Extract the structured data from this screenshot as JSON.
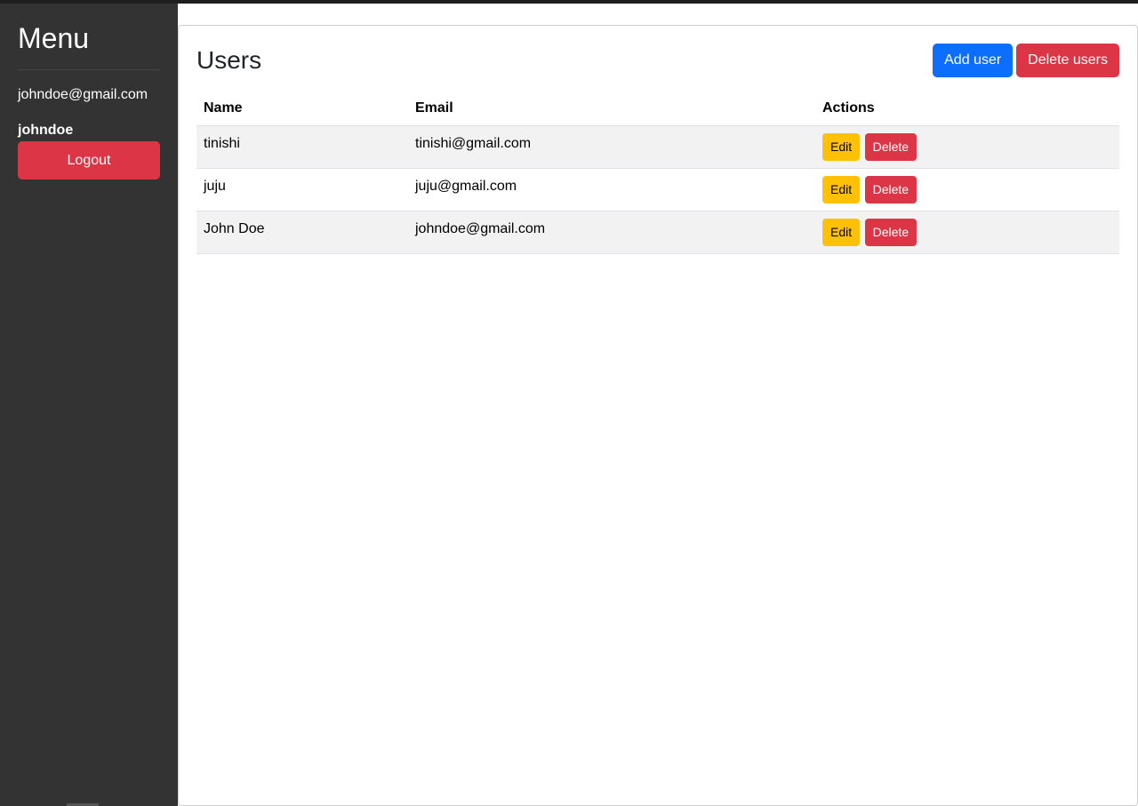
{
  "colors": {
    "sidebar_bg": "#333333",
    "primary": "#0d6efd",
    "danger": "#dc3545",
    "warning": "#ffc107"
  },
  "sidebar": {
    "title": "Menu",
    "email": "johndoe@gmail.com",
    "username": "johndoe",
    "logout_label": "Logout"
  },
  "main": {
    "title": "Users",
    "add_user_label": "Add user",
    "delete_users_label": "Delete users",
    "table": {
      "headers": [
        "Name",
        "Email",
        "Actions"
      ],
      "rows": [
        {
          "name": "tinishi",
          "email": "tinishi@gmail.com",
          "edit_label": "Edit",
          "delete_label": "Delete"
        },
        {
          "name": "juju",
          "email": "juju@gmail.com",
          "edit_label": "Edit",
          "delete_label": "Delete"
        },
        {
          "name": "John Doe",
          "email": "johndoe@gmail.com",
          "edit_label": "Edit",
          "delete_label": "Delete"
        }
      ]
    }
  }
}
